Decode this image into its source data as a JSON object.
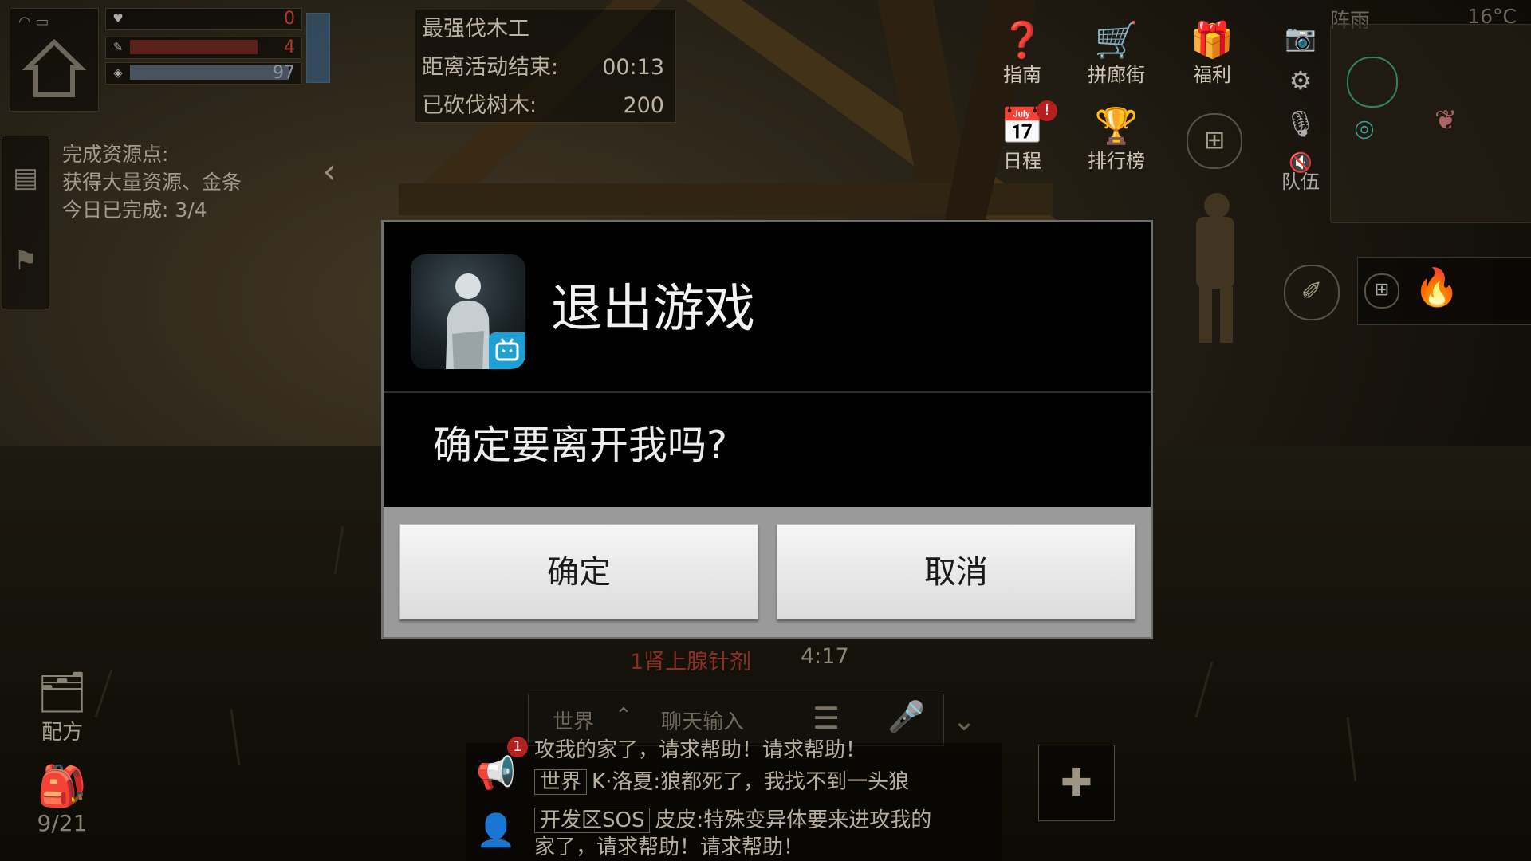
{
  "hud": {
    "stats": [
      {
        "icon": "heart-icon",
        "value": "0",
        "color": "#c0392b"
      },
      {
        "icon": "wrench-icon",
        "value": "4",
        "color": "#b03a2e"
      },
      {
        "icon": "pill-icon",
        "value": "97",
        "color": "#8a96a6"
      }
    ],
    "event": {
      "title": "最强伐木工",
      "countdown_label": "距离活动结束:",
      "countdown_value": "00:13",
      "chopped_label": "已砍伐树木:",
      "chopped_value": "200"
    },
    "quest": {
      "line1": "完成资源点:",
      "line2": "获得大量资源、金条",
      "line3": "今日已完成: 3/4"
    },
    "menu": {
      "guide": "指南",
      "arcade": "拼廊街",
      "welfare": "福利",
      "schedule": "日程",
      "ranking": "排行榜",
      "team": "队伍"
    },
    "weather": {
      "condition": "阵雨",
      "temperature": "16°C"
    },
    "recipe_label": "配方",
    "bag_label": "9/21"
  },
  "chat": {
    "item_notice": "1肾上腺针剂",
    "item_timer": "4:17",
    "channel": "世界",
    "input_placeholder": "聊天输入",
    "badge_count": "1",
    "lines": [
      {
        "text": "攻我的家了，请求帮助！请求帮助！"
      },
      {
        "chip": "世界",
        "text": "K·洛夏:狼都死了，我找不到一头狼"
      },
      {
        "chip": "开发区SOS",
        "text": "皮皮:特殊变异体要来进攻我的"
      },
      {
        "text": "家了，请求帮助！请求帮助！"
      }
    ]
  },
  "dialog": {
    "title": "退出游戏",
    "message": "确定要离开我吗?",
    "confirm_label": "确定",
    "cancel_label": "取消"
  }
}
